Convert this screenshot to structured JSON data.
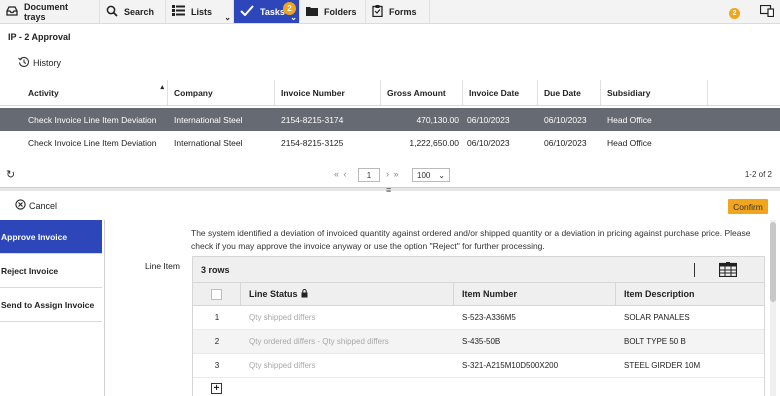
{
  "nav": {
    "items": [
      {
        "label": "Document trays",
        "icon": "tray-icon"
      },
      {
        "label": "Search",
        "icon": "search-icon"
      },
      {
        "label": "Lists",
        "icon": "list-icon"
      },
      {
        "label": "Tasks",
        "icon": "check-icon",
        "badge": "2",
        "active": true
      },
      {
        "label": "Folders",
        "icon": "folder-icon"
      },
      {
        "label": "Forms",
        "icon": "clipboard-icon"
      }
    ],
    "accent": "#2d46b9",
    "badge_color": "#f0a51c"
  },
  "header": {
    "title": "IP - 2 Approval",
    "badge": "2"
  },
  "history": {
    "label": "History"
  },
  "tasks_table": {
    "columns": [
      "Activity",
      "Company",
      "Invoice Number",
      "Gross Amount",
      "Invoice Date",
      "Due Date",
      "Subsidiary"
    ],
    "rows": [
      [
        "Check Invoice Line Item Deviation",
        "International Steel",
        "2154-8215-3174",
        "470,130.00",
        "06/10/2023",
        "06/10/2023",
        "Head Office"
      ],
      [
        "Check Invoice Line Item Deviation",
        "International Steel",
        "2154-8215-3125",
        "1,222,650.00",
        "06/10/2023",
        "06/10/2023",
        "Head Office"
      ]
    ],
    "selected_row": 0
  },
  "pager": {
    "page": "1",
    "page_size": "100",
    "count": "1-2 of 2"
  },
  "actions": {
    "cancel_label": "Cancel",
    "confirm_label": "Confirm"
  },
  "side_menu": {
    "items": [
      "Approve Invoice",
      "Reject Invoice",
      "Send to Assign Invoice"
    ],
    "active": 0
  },
  "description": "The system identified a deviation of invoiced quantity against ordered and/or shipped quantity or a deviation in pricing against purchase price. Please check if you may approve the invoice anyway or use the option \"Reject\" for further processing.",
  "line_item": {
    "label": "Line Item",
    "row_count": "3 rows",
    "columns": [
      "Line Status",
      "Item Number",
      "Item Description"
    ],
    "rows": [
      {
        "idx": "1",
        "status": "Qty shipped differs",
        "item_number": "S-523-A336M5",
        "description": "SOLAR PANALES"
      },
      {
        "idx": "2",
        "status": "Qty ordered differs - Qty shipped differs",
        "item_number": "S-435-50B",
        "description": "BOLT TYPE 50 B"
      },
      {
        "idx": "3",
        "status": "Qty shipped differs",
        "item_number": "S-321-A215M10D500X200",
        "description": "STEEL GIRDER 10M"
      }
    ]
  }
}
